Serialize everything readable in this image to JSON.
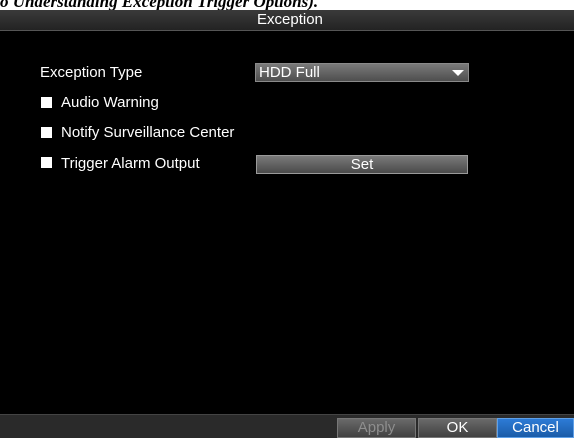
{
  "caption": "o Understanding Exception Trigger Options).",
  "window": {
    "title": "Exception"
  },
  "form": {
    "exception_type_label": "Exception Type",
    "exception_type_value": "HDD Full",
    "options": [
      {
        "label": "Audio Warning",
        "checked": false
      },
      {
        "label": "Notify Surveillance Center",
        "checked": false
      },
      {
        "label": "Trigger Alarm Output",
        "checked": false
      }
    ],
    "set_button_label": "Set"
  },
  "footer": {
    "apply_label": "Apply",
    "ok_label": "OK",
    "cancel_label": "Cancel"
  },
  "colors": {
    "background": "#000000",
    "text": "#ffffff",
    "accent_button": "#1f6cc2",
    "disabled_text": "#8e8e8e"
  }
}
